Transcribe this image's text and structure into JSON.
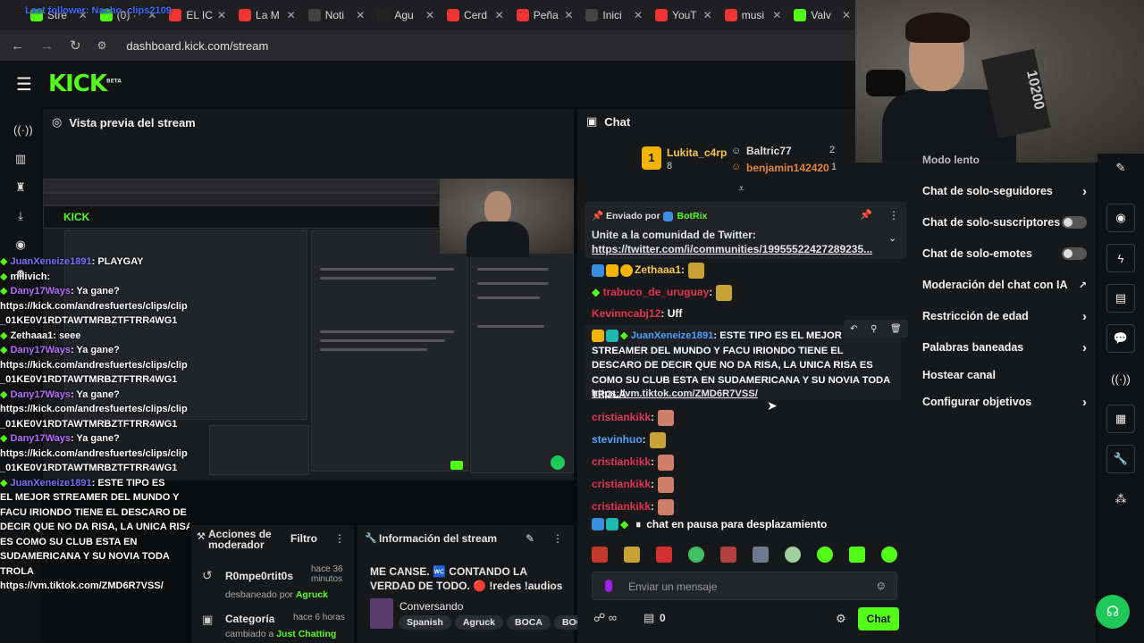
{
  "browser": {
    "tabs": [
      {
        "label": "Stre",
        "color": "#53fc18"
      },
      {
        "label": "(0) ·",
        "color": "#53fc18"
      },
      {
        "label": "EL IC",
        "color": "#e33"
      },
      {
        "label": "La M",
        "color": "#e33"
      },
      {
        "label": "Noti",
        "color": "#444"
      },
      {
        "label": "Agu",
        "color": "#222"
      },
      {
        "label": "Cerd",
        "color": "#e33"
      },
      {
        "label": "Peña",
        "color": "#e33"
      },
      {
        "label": "Inici",
        "color": "#444"
      },
      {
        "label": "YouT",
        "color": "#e33"
      },
      {
        "label": "musi",
        "color": "#e33"
      },
      {
        "label": "Valv",
        "color": "#53fc18"
      }
    ],
    "url": "dashboard.kick.com/stream",
    "overlay_title": "Last follower: Nacho_clips2109"
  },
  "kick": {
    "logo": "KICK",
    "beta": "BETA"
  },
  "preview": {
    "title": "Vista previa del stream"
  },
  "chat": {
    "title": "Chat",
    "top_gifters": [
      {
        "name": "Lukita_c4rp",
        "count": "8"
      },
      {
        "name": "Baltric77",
        "count": "2"
      },
      {
        "name": "benjamin142420",
        "count": "1"
      }
    ],
    "pinned": {
      "sent_by_label": "Enviado por",
      "sender": "BotRix",
      "text": "Unite a la comunidad de Twitter:",
      "link": "https://twitter.com/i/communities/19955522427289235..."
    },
    "messages": [
      {
        "user": "Zethaaa1",
        "color": "#f4c542",
        "text": ""
      },
      {
        "user": "trabuco_de_uruguay",
        "color": "#e0335a",
        "text": ""
      },
      {
        "user": "Kevinncabj12",
        "color": "#e0335a",
        "text": "Uff"
      },
      {
        "user": "JuanXeneize1891",
        "color": "#4aa3ff",
        "text": "ESTE TIPO ES EL MEJOR STREAMER DEL MUNDO Y FACU IRIONDO TIENE EL DESCARO DE DECIR QUE NO DA RISA, LA UNICA RISA ES COMO SU CLUB ESTA EN SUDAMERICANA Y SU NOVIA TODA TROLA",
        "link": "https://vm.tiktok.com/ZMD6R7VSS/"
      },
      {
        "user": "cristiankikk",
        "color": "#e0335a",
        "text": ""
      },
      {
        "user": "stevinhuo",
        "color": "#4aa3ff",
        "text": ""
      },
      {
        "user": "cristiankikk",
        "color": "#e0335a",
        "text": ""
      },
      {
        "user": "cristiankikk",
        "color": "#e0335a",
        "text": ""
      },
      {
        "user": "cristiankikk",
        "color": "#e0335a",
        "text": ""
      }
    ],
    "paused": "chat en pausa para desplazamiento",
    "input_placeholder": "Enviar un mensaje",
    "footer_count": "0",
    "send_label": "Chat"
  },
  "menu": {
    "partial_top": "Modo lento",
    "items": [
      {
        "label": "Chat de solo-seguidores",
        "kind": "chevron"
      },
      {
        "label": "Chat de solo-suscriptores",
        "kind": "toggle"
      },
      {
        "label": "Chat de solo-emotes",
        "kind": "toggle"
      },
      {
        "label": "Moderación del chat con IA",
        "kind": "external"
      },
      {
        "label": "Restricción de edad",
        "kind": "chevron"
      },
      {
        "label": "Palabras baneadas",
        "kind": "chevron"
      },
      {
        "label": "Hostear canal",
        "kind": "none"
      },
      {
        "label": "Configurar objetivos",
        "kind": "chevron"
      }
    ]
  },
  "mod_actions": {
    "title": "Acciones de moderador",
    "filter_label": "Filtro",
    "entries": [
      {
        "user": "R0mpe0rtit0s",
        "time": "hace 36 minutos",
        "detail": "desbaneado por",
        "by": "Agruck"
      },
      {
        "user": "Categoría",
        "time": "hace 6 horas",
        "detail": "cambiado a",
        "by": "Just Chatting"
      }
    ]
  },
  "stream_info": {
    "title": "Información del stream",
    "stream_title": "ME CANSE. 🚾 CONTANDO LA VERDAD DE TODO. 🔴 !redes !audios",
    "category": "Conversando",
    "tags": [
      "Spanish",
      "Agruck",
      "BOCA",
      "BOC"
    ]
  },
  "overlay_chat": [
    {
      "user": "JuanXeneize1891",
      "text": ": PLAYGAY",
      "color": "#7c6cff"
    },
    {
      "user": "milivich",
      "text": ":",
      "color": "#ffffff"
    },
    {
      "user": "Dany17Ways",
      "text": ": Ya gane?",
      "color": "#b46cff"
    },
    {
      "user": "",
      "text": "https://kick.com/andresfuertes/clips/clip",
      "color": "#ffffff"
    },
    {
      "user": "",
      "text": "_01KE0V1RDTAWTMRBZTFTRR4WG1",
      "color": "#ffffff"
    },
    {
      "user": "Zethaaa1",
      "text": ": seee",
      "color": "#ffffff"
    },
    {
      "user": "Dany17Ways",
      "text": ": Ya gane?",
      "color": "#b46cff"
    },
    {
      "user": "",
      "text": "https://kick.com/andresfuertes/clips/clip",
      "color": "#ffffff"
    },
    {
      "user": "",
      "text": "_01KE0V1RDTAWTMRBZTFTRR4WG1",
      "color": "#ffffff"
    },
    {
      "user": "Dany17Ways",
      "text": ": Ya gane?",
      "color": "#b46cff"
    },
    {
      "user": "",
      "text": "https://kick.com/andresfuertes/clips/clip",
      "color": "#ffffff"
    },
    {
      "user": "",
      "text": "_01KE0V1RDTAWTMRBZTFTRR4WG1",
      "color": "#ffffff"
    },
    {
      "user": "Dany17Ways",
      "text": ": Ya gane?",
      "color": "#b46cff"
    },
    {
      "user": "",
      "text": "https://kick.com/andresfuertes/clips/clip",
      "color": "#ffffff"
    },
    {
      "user": "",
      "text": "_01KE0V1RDTAWTMRBZTFTRR4WG1",
      "color": "#ffffff"
    },
    {
      "user": "JuanXeneize1891",
      "text": ": ESTE TIPO ES",
      "color": "#7c6cff"
    },
    {
      "user": "",
      "text": "EL MEJOR STREAMER DEL MUNDO Y",
      "color": "#ffffff"
    },
    {
      "user": "",
      "text": "FACU IRIONDO TIENE EL DESCARO DE",
      "color": "#ffffff"
    },
    {
      "user": "",
      "text": "DECIR QUE NO DA RISA, LA UNICA RISA",
      "color": "#ffffff"
    },
    {
      "user": "",
      "text": "ES COMO SU CLUB ESTA EN",
      "color": "#ffffff"
    },
    {
      "user": "",
      "text": "SUDAMERICANA Y SU NOVIA TODA",
      "color": "#ffffff"
    },
    {
      "user": "",
      "text": "TROLA",
      "color": "#ffffff"
    },
    {
      "user": "",
      "text": "https://vm.tiktok.com/ZMD6R7VSS/",
      "color": "#ffffff"
    }
  ],
  "colors": {
    "accent": "#53fc18",
    "panel": "#17181a",
    "bg": "#0b0c0d"
  }
}
